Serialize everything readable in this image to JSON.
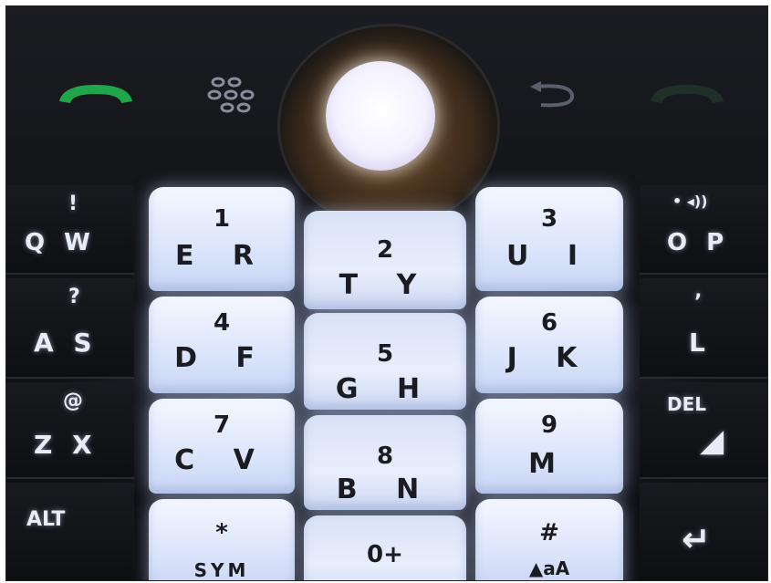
{
  "top_row": {
    "call_icon": "green-phone-icon",
    "menu_icon": "blackberry-dots-icon",
    "back_icon": "back-arrow-icon",
    "end_icon": "end-call-icon",
    "trackball": "trackball"
  },
  "left_keys": [
    {
      "top": "!",
      "main": "Q W"
    },
    {
      "top": "?",
      "main": "A S"
    },
    {
      "top": "@",
      "main": "Z X"
    },
    {
      "top": "",
      "main": "ALT"
    }
  ],
  "right_keys": [
    {
      "top": "• ◂))",
      "main": "O P"
    },
    {
      "top": "’",
      "main": "L"
    },
    {
      "top": "DEL",
      "main": "◢"
    },
    {
      "top": "",
      "main": "↵"
    }
  ],
  "center_keys": [
    {
      "num": "1",
      "letters": "E R"
    },
    {
      "num": "2",
      "letters": "T Y"
    },
    {
      "num": "3",
      "letters": "U I"
    },
    {
      "num": "4",
      "letters": "D F"
    },
    {
      "num": "5",
      "letters": "G H"
    },
    {
      "num": "6",
      "letters": "J K"
    },
    {
      "num": "7",
      "letters": "C V"
    },
    {
      "num": "8",
      "letters": "B N"
    },
    {
      "num": "9",
      "letters": "M"
    },
    {
      "num": "*",
      "letters": "SYM"
    },
    {
      "num": "0+",
      "letters": ""
    },
    {
      "num": "#",
      "letters": "▲aA"
    }
  ],
  "colors": {
    "call_green": "#1fa64a",
    "key_backlight": "#e6eeff",
    "body": "#111216"
  }
}
